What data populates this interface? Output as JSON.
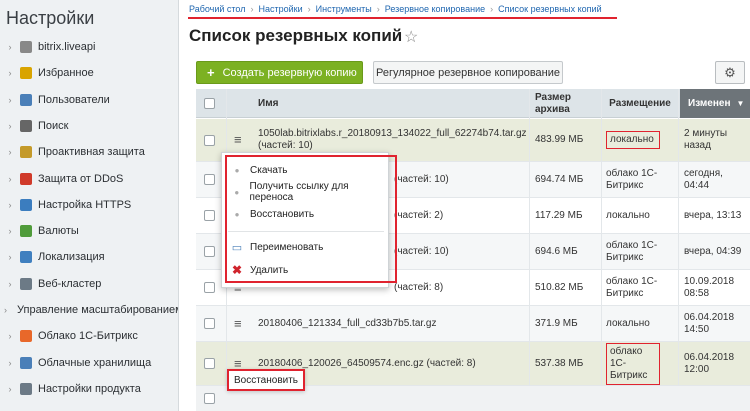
{
  "sidebar": {
    "title": "Настройки",
    "items": [
      {
        "label": "bitrix.liveapi",
        "icon": "bullet-icon",
        "color": "#888888"
      },
      {
        "label": "Избранное",
        "icon": "star-icon",
        "color": "#d9a400"
      },
      {
        "label": "Пользователи",
        "icon": "user-icon",
        "color": "#4a7fb8"
      },
      {
        "label": "Поиск",
        "icon": "search-icon",
        "color": "#666666"
      },
      {
        "label": "Проактивная защита",
        "icon": "lock-icon",
        "color": "#c49a2a"
      },
      {
        "label": "Защита от DDoS",
        "icon": "shield-icon",
        "color": "#d03a2a"
      },
      {
        "label": "Настройка HTTPS",
        "icon": "https-icon",
        "color": "#3b7dbf"
      },
      {
        "label": "Валюты",
        "icon": "currency-icon",
        "color": "#4f9b3a"
      },
      {
        "label": "Локализация",
        "icon": "globe-icon",
        "color": "#3f7fbf"
      },
      {
        "label": "Веб-кластер",
        "icon": "cluster-icon",
        "color": "#6c7a86"
      },
      {
        "label": "Управление масштабированием",
        "icon": "scale-icon",
        "color": "#6c7a86"
      },
      {
        "label": "Облако 1С-Битрикс",
        "icon": "cloud-icon",
        "color": "#e8682a"
      },
      {
        "label": "Облачные хранилища",
        "icon": "storage-icon",
        "color": "#4a7fb8"
      },
      {
        "label": "Настройки продукта",
        "icon": "gear-icon",
        "color": "#6c7a86"
      }
    ]
  },
  "breadcrumbs": [
    "Рабочий стол",
    "Настройки",
    "Инструменты",
    "Резервное копирование",
    "Список резервных копий"
  ],
  "page_title": "Список резервных копий",
  "toolbar": {
    "create_label": "Создать резервную копию",
    "regular_label": "Регулярное резервное копирование"
  },
  "table": {
    "headers": {
      "name": "Имя",
      "size": "Размер архива",
      "placement": "Размещение",
      "changed": "Изменен"
    },
    "rows": [
      {
        "name": "1050lab.bitrixlabs.r_20180913_134022_full_62274b74.tar.gz (частей: 10)",
        "size": "483.99 МБ",
        "placement": "локально",
        "changed": "2 минуты назад"
      },
      {
        "name": "(частей: 10)",
        "size": "694.74 МБ",
        "placement": "облако 1С-Битрикс",
        "changed": "сегодня, 04:44"
      },
      {
        "name": "(частей: 2)",
        "size": "117.29 МБ",
        "placement": "локально",
        "changed": "вчера, 13:13"
      },
      {
        "name": "(частей: 10)",
        "size": "694.6 МБ",
        "placement": "облако 1С-Битрикс",
        "changed": "вчера, 04:39"
      },
      {
        "name": "(частей: 8)",
        "size": "510.82 МБ",
        "placement": "облако 1С-Битрикс",
        "changed": "10.09.2018 08:58"
      },
      {
        "name": "20180406_121334_full_cd33b7b5.tar.gz",
        "size": "371.9 МБ",
        "placement": "локально",
        "changed": "06.04.2018 14:50"
      },
      {
        "name": "20180406_120026_64509574.enc.gz (частей: 8)",
        "size": "537.38 МБ",
        "placement": "облако 1С-Битрикс",
        "changed": "06.04.2018 12:00"
      }
    ]
  },
  "context_menu": {
    "items": [
      "Скачать",
      "Получить ссылку для переноса",
      "Восстановить",
      "Переименовать",
      "Удалить"
    ]
  },
  "restore_popup": "Восстановить",
  "colors": {
    "accent_red": "#e0232f",
    "create_green": "#7cb122",
    "link_blue": "#2067b0"
  }
}
